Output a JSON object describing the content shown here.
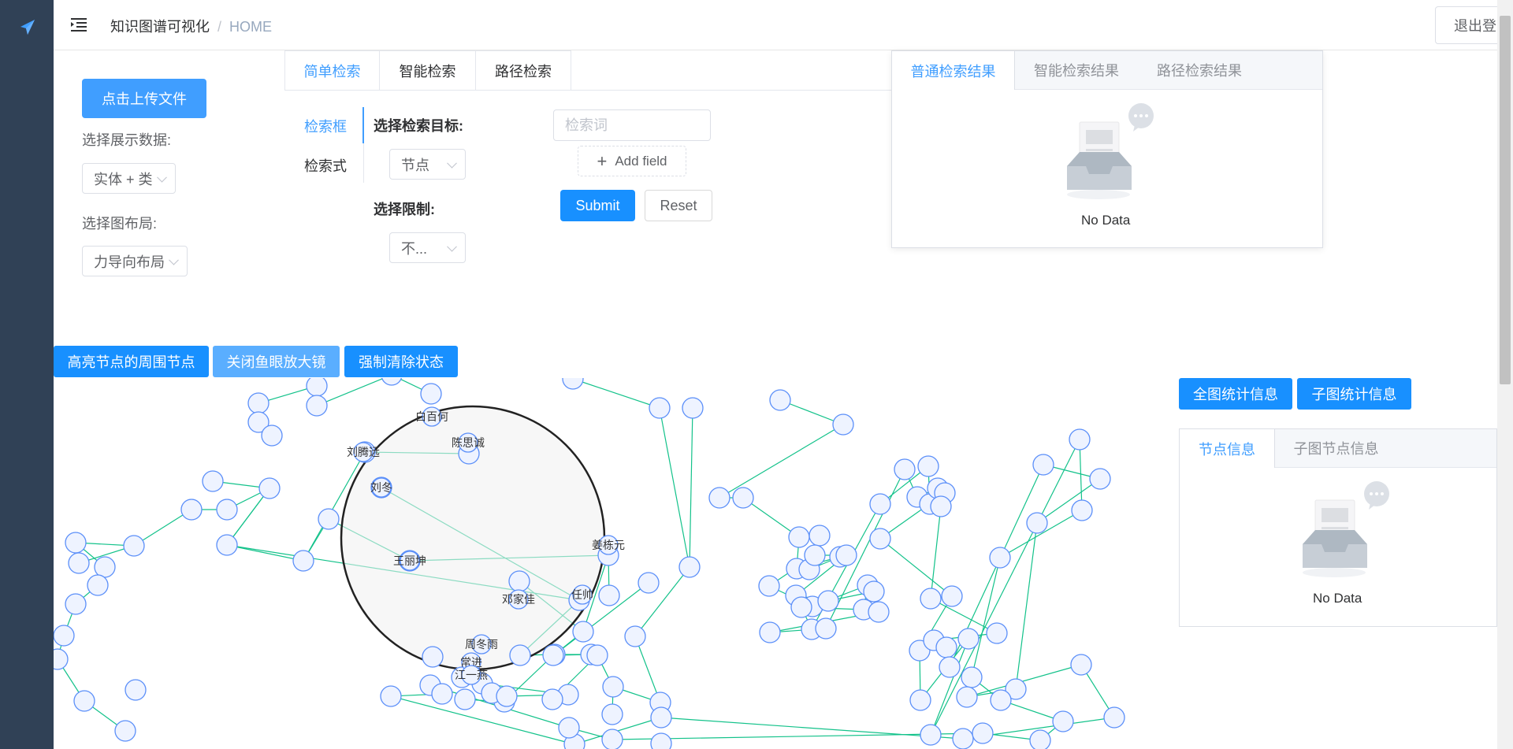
{
  "header": {
    "breadcrumb_title": "知识图谱可视化",
    "breadcrumb_sep": "/",
    "breadcrumb_home": "HOME",
    "logout_label": "退出登录"
  },
  "left_panel": {
    "upload_label": "点击上传文件",
    "data_label": "选择展示数据:",
    "data_value": "实体 + 类",
    "layout_label": "选择图布局:",
    "layout_value": "力导向布局"
  },
  "search": {
    "tabs": [
      "简单检索",
      "智能检索",
      "路径检索"
    ],
    "active_tab": "简单检索",
    "side_tabs": [
      "检索框",
      "检索式"
    ],
    "target_label": "选择检索目标:",
    "target_value": "节点",
    "limit_label": "选择限制:",
    "limit_value": "不...",
    "keyword_placeholder": "检索词",
    "add_field_label": "Add field",
    "submit_label": "Submit",
    "reset_label": "Reset"
  },
  "results": {
    "tabs": [
      "普通检索结果",
      "智能检索结果",
      "路径检索结果"
    ],
    "empty_text": "No Data"
  },
  "graph_toolbar": {
    "highlight_label": "高亮节点的周围节点",
    "fisheye_label": "关闭鱼眼放大镜",
    "clear_label": "强制清除状态"
  },
  "stats": {
    "full_label": "全图统计信息",
    "sub_label": "子图统计信息"
  },
  "node_info": {
    "tabs": [
      "节点信息",
      "子图节点信息"
    ],
    "empty_text": "No Data"
  },
  "graph": {
    "labels": [
      "白百何",
      "陈思诚",
      "刘腾远",
      "刘冬",
      "王丽坤",
      "姜栋元",
      "邓家佳",
      "任帅",
      "周冬雨",
      "常进",
      "江一燕"
    ]
  },
  "colors": {
    "sidebar": "#304156",
    "primary": "#409eff",
    "edge": "#13c28a",
    "node_stroke": "#5b8ff9",
    "node_fill": "#eef3ff"
  }
}
